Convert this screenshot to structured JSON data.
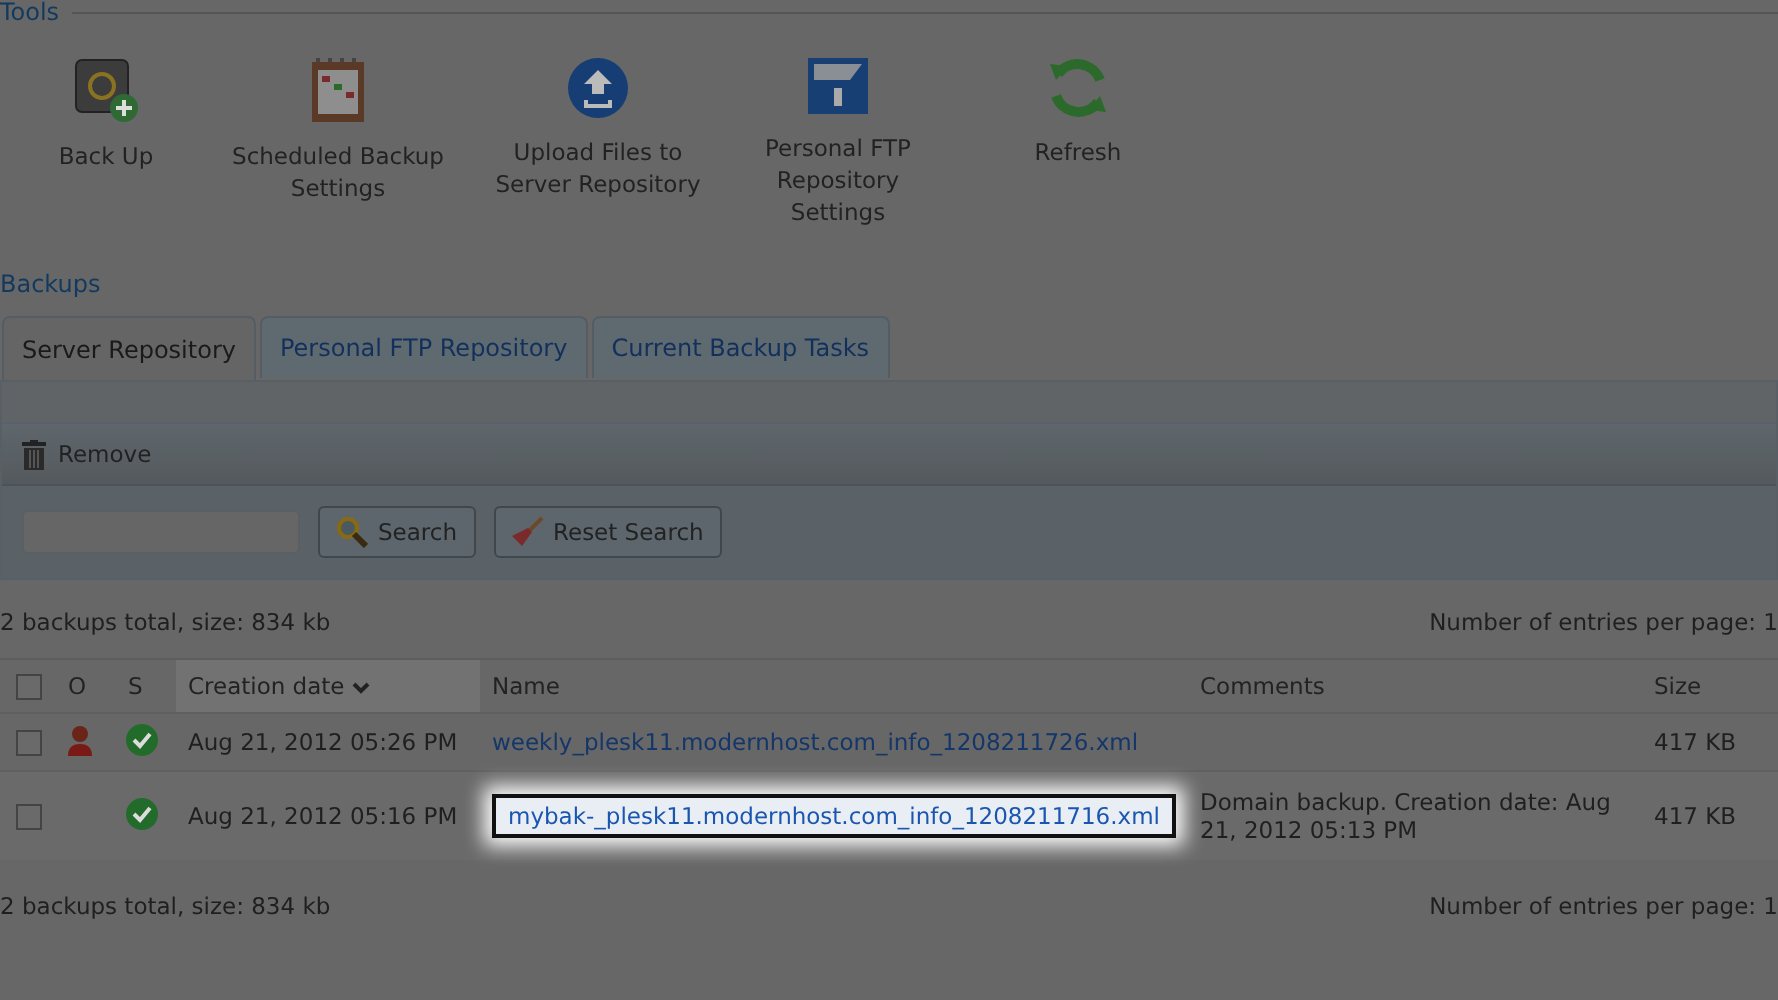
{
  "tools_heading": "Tools",
  "tools": [
    {
      "kind": "safe",
      "label": "Back Up"
    },
    {
      "kind": "calendar",
      "label": "Scheduled Backup Settings"
    },
    {
      "kind": "upload",
      "label": "Upload Files to Server Repository"
    },
    {
      "kind": "ftp",
      "label": "Personal FTP Repository Settings"
    },
    {
      "kind": "refresh",
      "label": "Refresh"
    }
  ],
  "backups_heading": "Backups",
  "tabs": [
    {
      "label": "Server Repository",
      "selected": true
    },
    {
      "label": "Personal FTP Repository",
      "selected": false
    },
    {
      "label": "Current Backup Tasks",
      "selected": false
    }
  ],
  "remove_button": "Remove",
  "search_button": "Search",
  "reset_button": "Reset Search",
  "summary_top": "2 backups total, size: 834 kb",
  "per_page_top": "Number of entries per page: 1",
  "columns": [
    {
      "kind": "check",
      "checked": false
    },
    {
      "kind": "text",
      "label": "O"
    },
    {
      "kind": "text",
      "label": "S"
    },
    {
      "kind": "sort",
      "label": "Creation date"
    },
    {
      "kind": "text",
      "label": "Name"
    },
    {
      "kind": "text",
      "label": "Comments"
    },
    {
      "kind": "text",
      "label": "Size"
    }
  ],
  "rows": [
    {
      "checked": false,
      "owner": true,
      "status_ok": true,
      "date": "Aug 21, 2012 05:26 PM",
      "name": "weekly_plesk11.modernhost.com_info_1208211726.xml",
      "highlighted": false,
      "size": "417 KB"
    },
    {
      "checked": false,
      "owner": false,
      "status_ok": true,
      "date": "Aug 21, 2012 05:16 PM",
      "name": "mybak-_plesk11.modernhost.com_info_1208211716.xml",
      "highlighted": true,
      "comments": "Domain backup. Creation date: Aug 21, 2012 05:13 PM",
      "size": "417 KB"
    }
  ],
  "summary_bottom": "2 backups total, size: 834 kb",
  "per_page_bottom": "Number of entries per page: 1"
}
